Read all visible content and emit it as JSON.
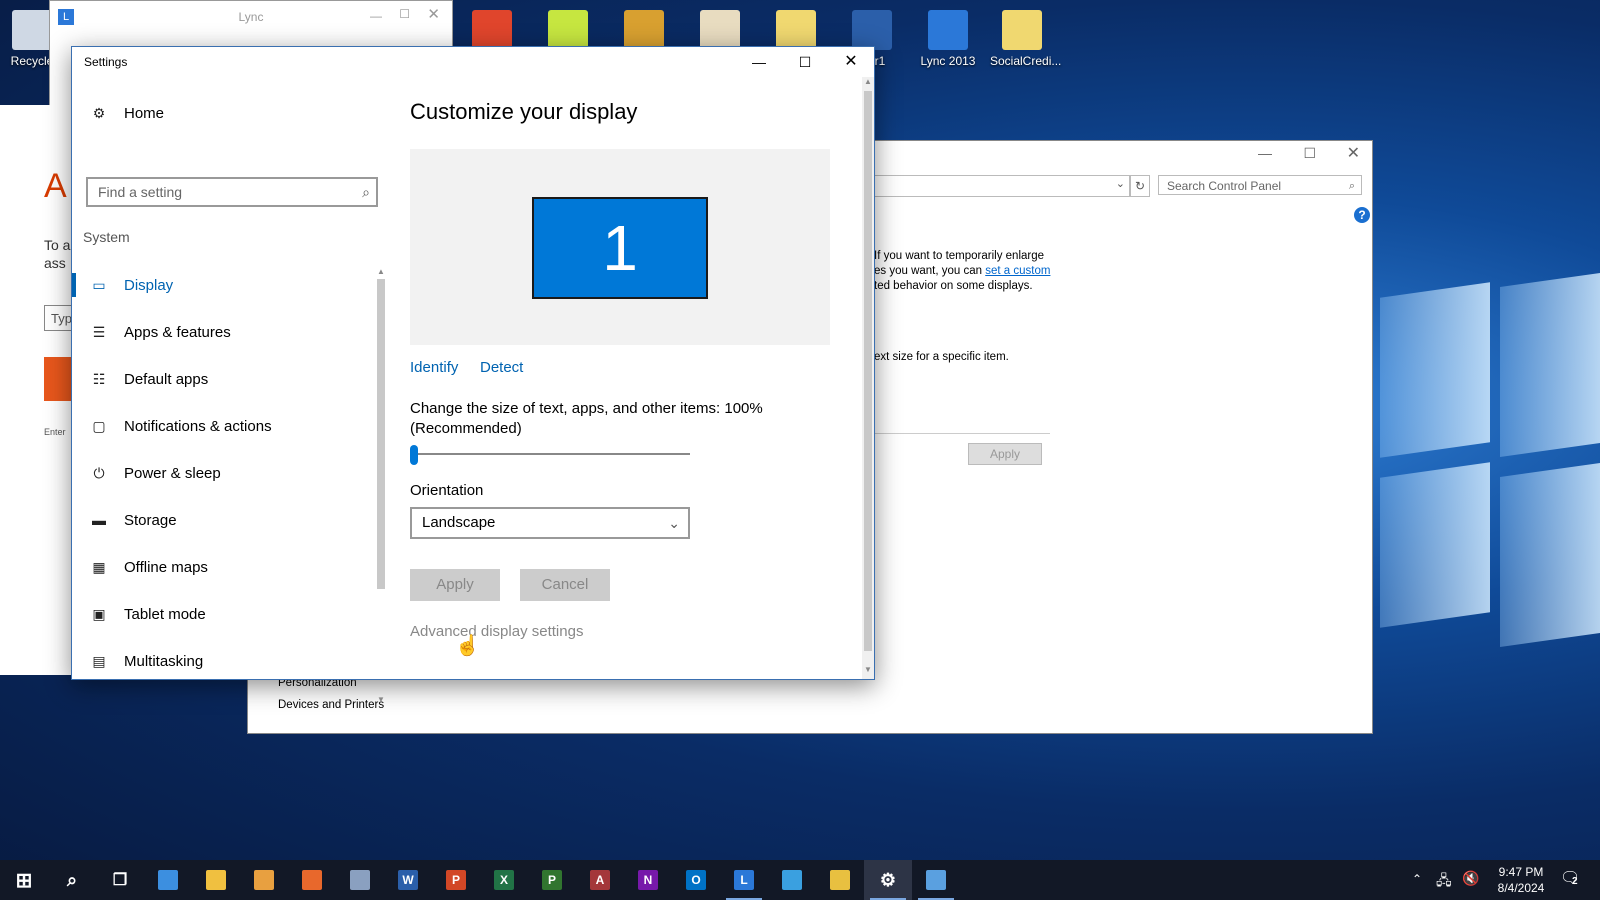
{
  "desktop": {
    "icons": [
      {
        "label": "Recycle",
        "color": "#cfd8e4"
      },
      {
        "label": "",
        "color": "#e0452c"
      },
      {
        "label": "",
        "color": "#c6e640"
      },
      {
        "label": "",
        "color": "#d8a030"
      },
      {
        "label": "",
        "color": "#e8dcc0"
      },
      {
        "label": "",
        "color": "#f0d870"
      },
      {
        "label": "diar1",
        "color": "#2b5faa"
      },
      {
        "label": "Lync 2013",
        "color": "#2b78d8"
      },
      {
        "label": "SocialCredi...",
        "color": "#f0d870"
      }
    ]
  },
  "lync_window": {
    "title": "Lync"
  },
  "left_bg": {
    "heading_letter": "A",
    "text1": "To a",
    "text2": "ass",
    "input_value": "Typ",
    "footer": "Enter"
  },
  "control_panel": {
    "search_placeholder": "Search Control Panel",
    "text_line1": "If you want to temporarily enlarge",
    "text_line2_pre": "es you want, you can ",
    "text_line2_link": "set a custom",
    "text_line3": "ted behavior on some displays.",
    "text_line4": "ext size for a specific item.",
    "apply_label": "Apply",
    "see_also_1": "Personalization",
    "see_also_2": "Devices and Printers"
  },
  "settings": {
    "window_title": "Settings",
    "home_label": "Home",
    "search_placeholder": "Find a setting",
    "section_label": "System",
    "nav_items": [
      {
        "label": "Display",
        "icon": "monitor-icon"
      },
      {
        "label": "Apps & features",
        "icon": "list-icon"
      },
      {
        "label": "Default apps",
        "icon": "default-apps-icon"
      },
      {
        "label": "Notifications & actions",
        "icon": "notification-icon"
      },
      {
        "label": "Power & sleep",
        "icon": "power-icon"
      },
      {
        "label": "Storage",
        "icon": "storage-icon"
      },
      {
        "label": "Offline maps",
        "icon": "map-icon"
      },
      {
        "label": "Tablet mode",
        "icon": "tablet-icon"
      },
      {
        "label": "Multitasking",
        "icon": "multitasking-icon"
      }
    ],
    "page_title": "Customize your display",
    "monitor_number": "1",
    "identify_label": "Identify",
    "detect_label": "Detect",
    "scale_label_line1": "Change the size of text, apps, and other items: 100%",
    "scale_label_line2": "(Recommended)",
    "scale_value_fraction": 0.0,
    "orientation_label": "Orientation",
    "orientation_value": "Landscape",
    "apply_label": "Apply",
    "cancel_label": "Cancel",
    "advanced_link": "Advanced display settings",
    "accent_color": "#0063b1"
  },
  "taskbar": {
    "apps": [
      {
        "name": "start-icon",
        "color": "#ffffff"
      },
      {
        "name": "search-icon",
        "color": "#ffffff"
      },
      {
        "name": "task-view-icon",
        "color": "#ffffff"
      },
      {
        "name": "edge-icon",
        "color": "#3c8fe0"
      },
      {
        "name": "file-explorer-icon",
        "color": "#f0c040"
      },
      {
        "name": "media-icon",
        "color": "#e8a040"
      },
      {
        "name": "firefox-icon",
        "color": "#e8682c"
      },
      {
        "name": "app-icon",
        "color": "#8aa0c0"
      },
      {
        "name": "word-icon",
        "color": "#2b5faa",
        "letter": "W"
      },
      {
        "name": "powerpoint-icon",
        "color": "#d24726",
        "letter": "P"
      },
      {
        "name": "excel-icon",
        "color": "#217346",
        "letter": "X"
      },
      {
        "name": "project-icon",
        "color": "#31752f",
        "letter": "P"
      },
      {
        "name": "access-icon",
        "color": "#a4373a",
        "letter": "A"
      },
      {
        "name": "onenote-icon",
        "color": "#7719aa",
        "letter": "N"
      },
      {
        "name": "outlook-icon",
        "color": "#0072c6",
        "letter": "O"
      },
      {
        "name": "lync-icon",
        "color": "#2b78d8",
        "letter": "L"
      },
      {
        "name": "remote-icon",
        "color": "#3aa0e0"
      },
      {
        "name": "network-icon",
        "color": "#e8c040"
      },
      {
        "name": "settings-icon",
        "color": "#ffffff"
      },
      {
        "name": "control-panel-icon",
        "color": "#5aa0e0"
      }
    ],
    "time": "9:47 PM",
    "date": "8/4/2024",
    "notification_count": "2"
  }
}
